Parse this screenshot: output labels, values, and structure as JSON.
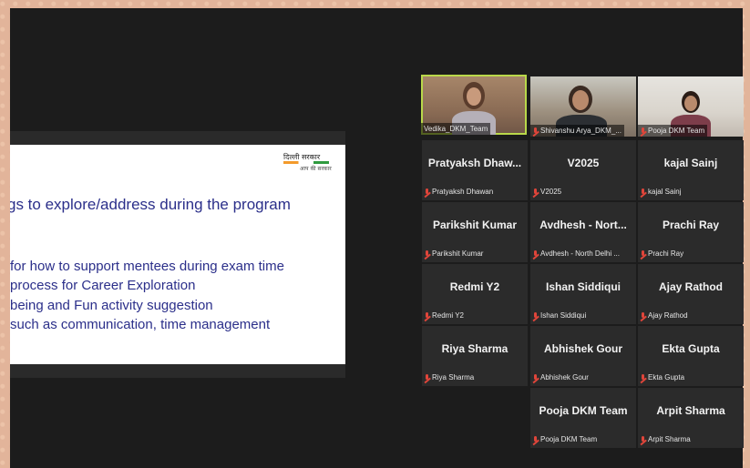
{
  "slide": {
    "logo_title": "दिल्ली सरकार",
    "logo_sub": "आप की सरकार",
    "heading": "gs to explore/address during the program",
    "lines": [
      "for how to support mentees during exam time",
      "process for Career Exploration",
      "being and Fun activity suggestion",
      "such as communication, time management"
    ]
  },
  "participants": [
    {
      "name": "Vedika_DKM_Team",
      "video": true
    },
    {
      "name": "Shivanshu Arya_DKM_...",
      "video": true
    },
    {
      "name": "Pooja DKM Team",
      "video": true
    },
    {
      "display": "Pratyaksh  Dhaw...",
      "name": "Pratyaksh Dhawan"
    },
    {
      "display": "V2025",
      "name": "V2025"
    },
    {
      "display": "kajal Sainj",
      "name": "kajal Sainj"
    },
    {
      "display": "Parikshit Kumar",
      "name": "Parikshit Kumar"
    },
    {
      "display": "Avdhesh  -  Nort...",
      "name": "Avdhesh - North Delhi ..."
    },
    {
      "display": "Prachi Ray",
      "name": "Prachi Ray"
    },
    {
      "display": "Redmi Y2",
      "name": "Redmi Y2"
    },
    {
      "display": "Ishan Siddiqui",
      "name": "Ishan Siddiqui"
    },
    {
      "display": "Ajay Rathod",
      "name": "Ajay Rathod"
    },
    {
      "display": "Riya Sharma",
      "name": "Riya Sharma"
    },
    {
      "display": "Abhishek Gour",
      "name": "Abhishek Gour"
    },
    {
      "display": "Ekta Gupta",
      "name": "Ekta Gupta"
    },
    {
      "display": "Pooja DKM Team",
      "name": "Pooja DKM Team"
    },
    {
      "display": "Arpit Sharma",
      "name": "Arpit Sharma"
    }
  ],
  "colors": {
    "active_speaker": "#b9d84a",
    "muted_mic": "#e0453a",
    "slide_text": "#2b2f8a"
  }
}
